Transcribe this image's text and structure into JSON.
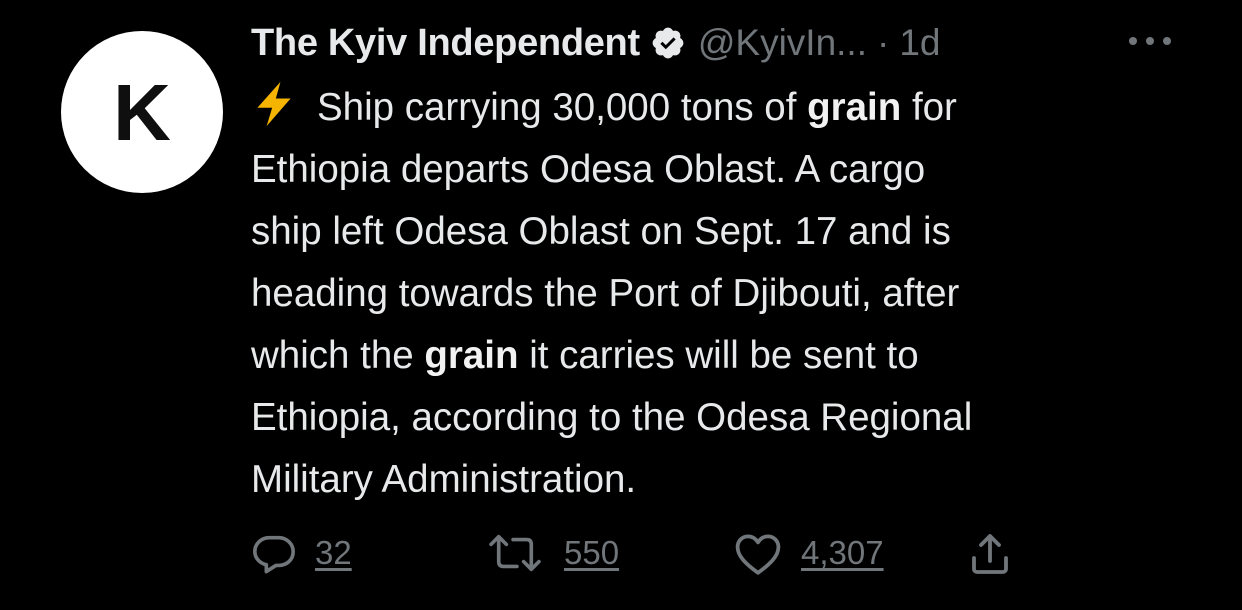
{
  "author": {
    "avatar_letter": "K",
    "name": "The Kyiv Independent",
    "handle": "@KyivIn...",
    "separator": "·",
    "time": "1d"
  },
  "tweet": {
    "lines": [
      [
        "Ship carrying 30,000 tons of ",
        "grain",
        " for"
      ],
      [
        "Ethiopia departs Odesa Oblast. A cargo"
      ],
      [
        "ship left Odesa Oblast on Sept. 17 and is"
      ],
      [
        "heading towards the Port of Djibouti, after"
      ],
      [
        "which the ",
        "grain",
        " it carries will be sent to"
      ],
      [
        "Ethiopia, according to the Odesa Regional"
      ],
      [
        "Military Administration."
      ]
    ]
  },
  "actions": {
    "reply_count": "32",
    "retweet_count": "550",
    "like_count": "4,307"
  },
  "icons": {
    "verified": "verified-badge-icon",
    "bolt": "lightning-bolt-icon",
    "more": "more-options-icon",
    "reply": "reply-icon",
    "retweet": "retweet-icon",
    "like": "heart-icon",
    "share": "share-icon"
  },
  "colors": {
    "background": "#000000",
    "text": "#e7e9ea",
    "muted": "#71767b",
    "bolt": "#f5b400"
  }
}
